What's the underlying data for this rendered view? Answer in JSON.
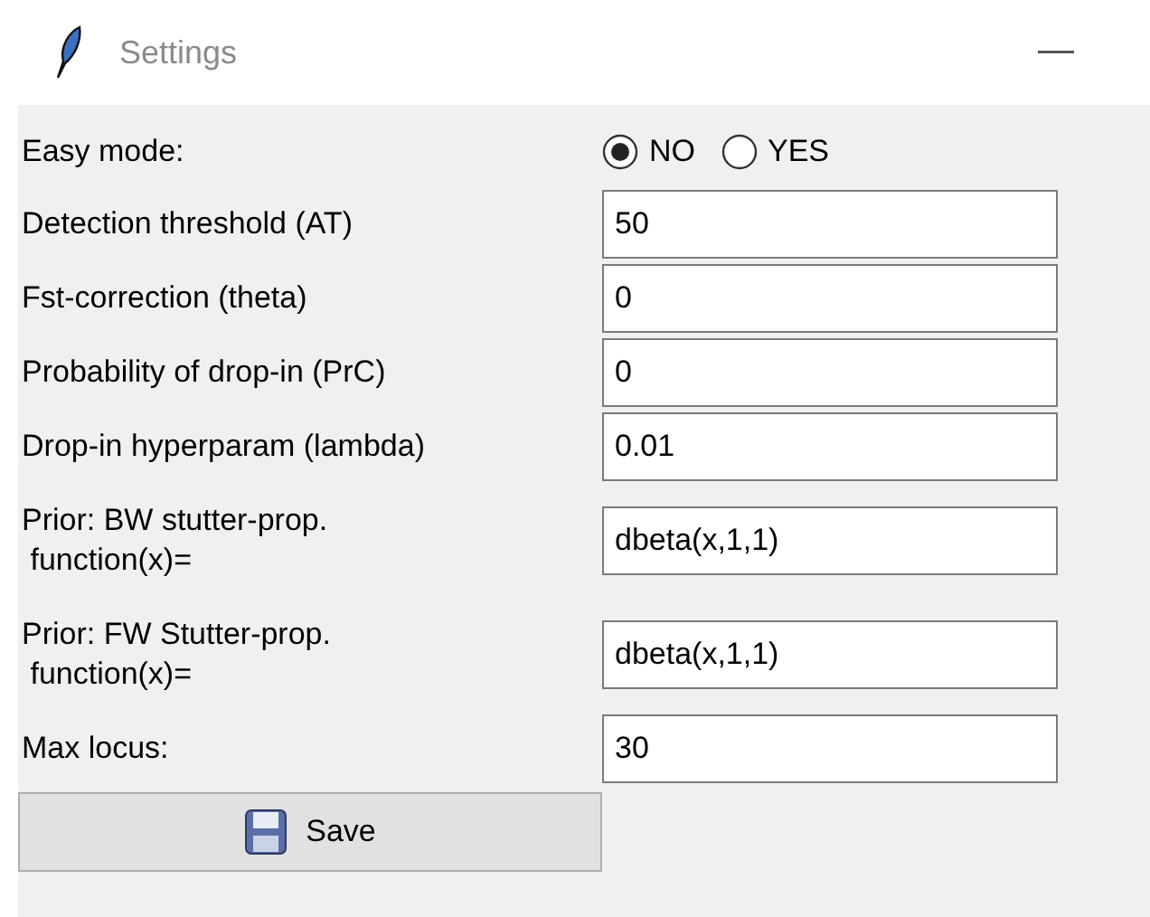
{
  "window": {
    "title": "Settings"
  },
  "easy_mode": {
    "label": "Easy mode:",
    "options": [
      {
        "label": "NO",
        "selected": true
      },
      {
        "label": "YES",
        "selected": false
      }
    ]
  },
  "fields": [
    {
      "label": "Detection threshold (AT)",
      "value": "50"
    },
    {
      "label": "Fst-correction (theta)",
      "value": "0"
    },
    {
      "label": "Probability of drop-in (PrC)",
      "value": "0"
    },
    {
      "label": "Drop-in hyperparam (lambda)",
      "value": "0.01"
    },
    {
      "label": "Prior: BW stutter-prop.\n function(x)=",
      "value": "dbeta(x,1,1)"
    },
    {
      "label": "Prior: FW Stutter-prop.\n function(x)=",
      "value": "dbeta(x,1,1)"
    },
    {
      "label": "Max locus:",
      "value": "30"
    }
  ],
  "save_button": {
    "label": "Save"
  }
}
